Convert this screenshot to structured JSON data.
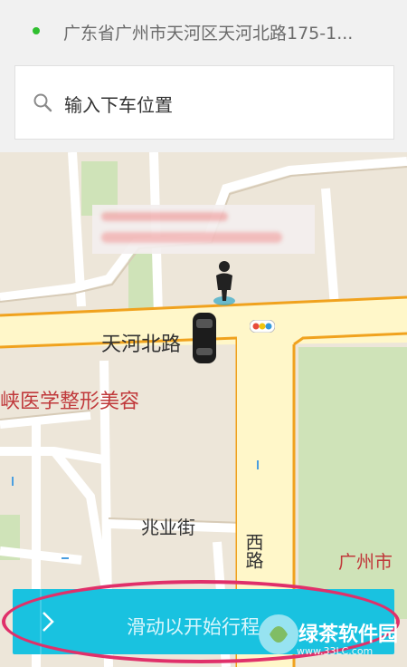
{
  "pickup": {
    "address": "广东省广州市天河区天河北路175-1..."
  },
  "search": {
    "placeholder": "输入下车位置"
  },
  "map": {
    "road_tianhe_north": "天河北路",
    "poi_clinic": "峡医学整形美容",
    "street_zhaoye": "兆业街",
    "road_west": "西路",
    "district_guangzhou": "广州市"
  },
  "slide": {
    "label": "滑动以开始行程"
  },
  "watermark": {
    "brand": "绿茶软件园",
    "url": "www.33LC.com"
  },
  "colors": {
    "accent": "#19c2e0",
    "status_green": "#2fbf2f",
    "annotation": "#e0306a"
  }
}
